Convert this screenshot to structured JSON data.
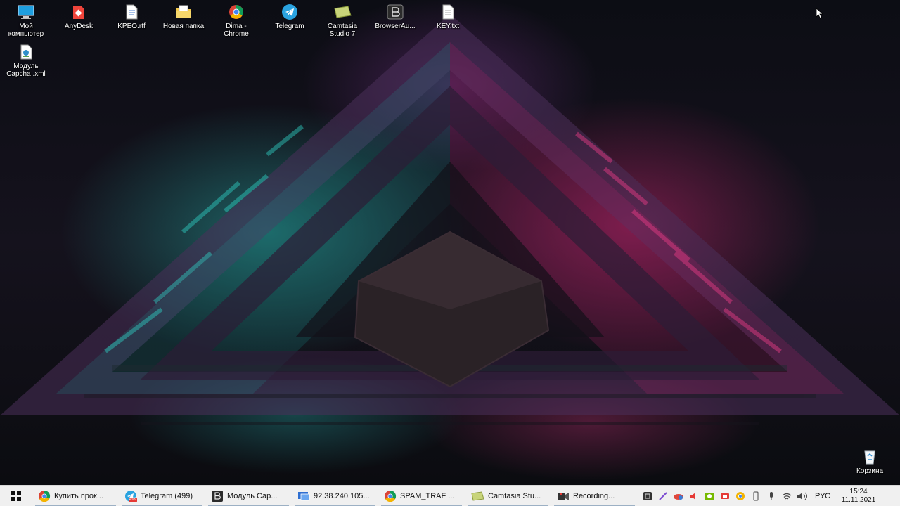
{
  "desktop": {
    "icons": [
      {
        "label": "Мой\nкомпьютер",
        "icon": "monitor-icon"
      },
      {
        "label": "AnyDesk",
        "icon": "anydesk-icon"
      },
      {
        "label": "KPEO.rtf",
        "icon": "rtf-file-icon"
      },
      {
        "label": "Новая папка",
        "icon": "folder-icon"
      },
      {
        "label": "Dima -\nChrome",
        "icon": "chrome-icon"
      },
      {
        "label": "Telegram",
        "icon": "telegram-icon"
      },
      {
        "label": "Camtasia\nStudio 7",
        "icon": "camtasia-icon"
      },
      {
        "label": "BrowserAu...",
        "icon": "browser-automation-icon"
      },
      {
        "label": "KEY.txt",
        "icon": "txt-file-icon"
      },
      {
        "label": "Модуль\nCapcha .xml",
        "icon": "xml-file-icon"
      }
    ],
    "recycle_bin": {
      "label": "Корзина",
      "icon": "recycle-bin-icon"
    }
  },
  "taskbar": {
    "buttons": [
      {
        "label": "Купить прок...",
        "icon": "chrome-icon"
      },
      {
        "label": "Telegram (499)",
        "icon": "telegram-icon",
        "badge": "499"
      },
      {
        "label": "Модуль Cap...",
        "icon": "browser-automation-icon"
      },
      {
        "label": "92.38.240.105...",
        "icon": "remote-desktop-icon"
      },
      {
        "label": "SPAM_TRAF ...",
        "icon": "chrome-icon"
      },
      {
        "label": "Camtasia Stu...",
        "icon": "camtasia-icon"
      },
      {
        "label": "Recording...",
        "icon": "recording-icon"
      }
    ],
    "tray": {
      "language": "РУС",
      "time": "15:24",
      "date": "11.11.2021"
    }
  },
  "colors": {
    "taskbar_bg": "#f0f0f0",
    "accent_teal": "#28bea f",
    "accent_pink": "#dc2878"
  }
}
